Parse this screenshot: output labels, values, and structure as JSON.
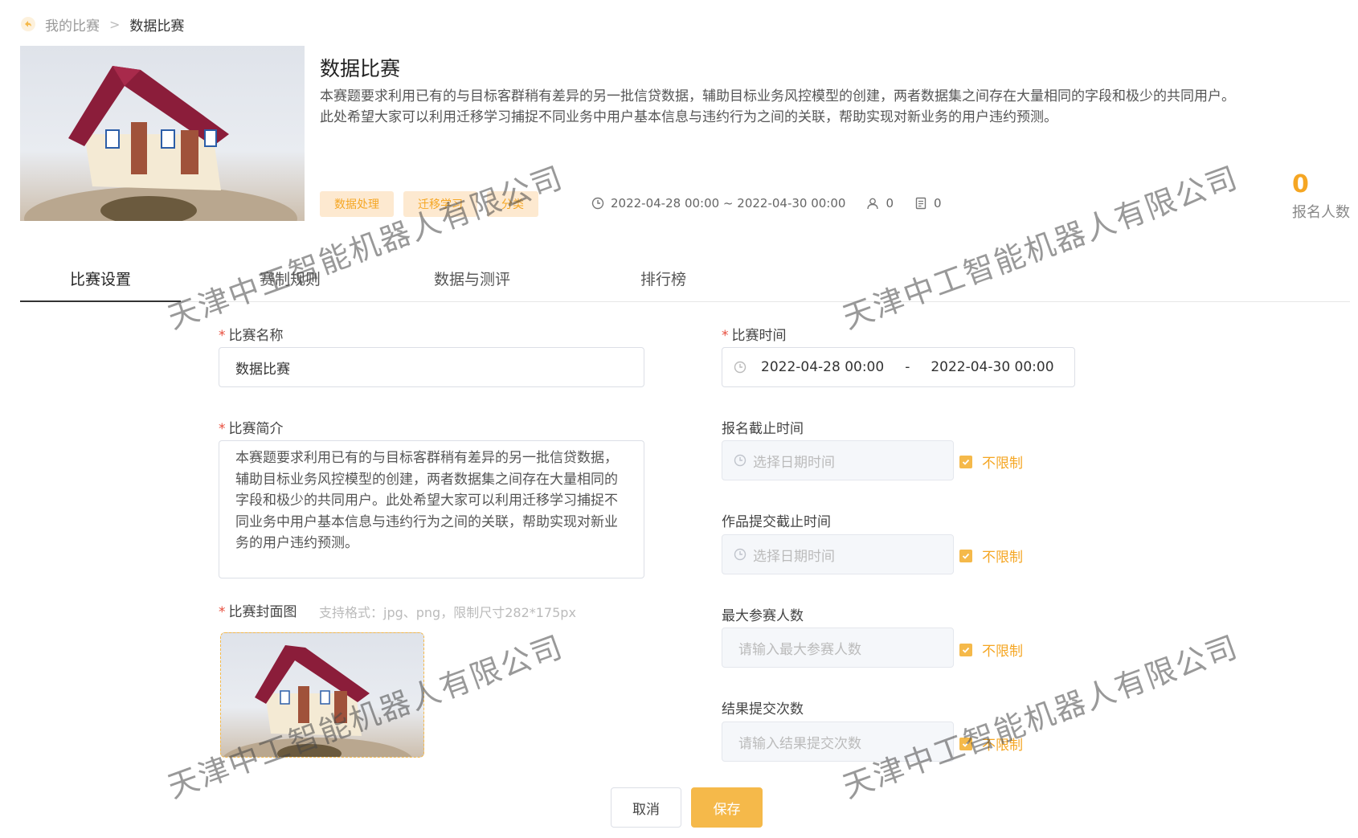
{
  "breadcrumb": {
    "parent": "我的比赛",
    "separator": ">",
    "current": "数据比赛"
  },
  "competition": {
    "title": "数据比赛",
    "description": "本赛题要求利用已有的与目标客群稍有差异的另一批信贷数据，辅助目标业务风控模型的创建，两者数据集之间存在大量相同的字段和极少的共同用户。此处希望大家可以利用迁移学习捕捉不同业务中用户基本信息与违约行为之间的关联，帮助实现对新业务的用户违约预测。",
    "tags": [
      "数据处理",
      "迁移学习",
      "分类"
    ],
    "time_range": "2022-04-28 00:00 ~ 2022-04-30 00:00",
    "participants": "0",
    "submissions": "0",
    "signup_count": "0",
    "signup_label": "报名人数"
  },
  "tabs": [
    "比赛设置",
    "赛制规则",
    "数据与测评",
    "排行榜"
  ],
  "form": {
    "name_label": "比赛名称",
    "name_value": "数据比赛",
    "intro_label": "比赛简介",
    "intro_value": "本赛题要求利用已有的与目标客群稍有差异的另一批信贷数据，辅助目标业务风控模型的创建，两者数据集之间存在大量相同的字段和极少的共同用户。此处希望大家可以利用迁移学习捕捉不同业务中用户基本信息与违约行为之间的关联，帮助实现对新业务的用户违约预测。",
    "cover_label": "比赛封面图",
    "cover_hint": "支持格式：jpg、png，限制尺寸282*175px",
    "time_label": "比赛时间",
    "time_start": "2022-04-28 00:00",
    "time_sep": "-",
    "time_end": "2022-04-30 00:00",
    "signup_deadline_label": "报名截止时间",
    "signup_deadline_placeholder": "选择日期时间",
    "submit_deadline_label": "作品提交截止时间",
    "submit_deadline_placeholder": "选择日期时间",
    "max_participants_label": "最大参赛人数",
    "max_participants_placeholder": "请输入最大参赛人数",
    "result_submits_label": "结果提交次数",
    "result_submits_placeholder": "请输入结果提交次数",
    "unlimited_label": "不限制"
  },
  "buttons": {
    "cancel": "取消",
    "save": "保存"
  },
  "watermark": "天津中工智能机器人有限公司",
  "colors": {
    "accent": "#f5b94a",
    "tag_bg": "#fde9d0",
    "required": "#e74c3c"
  }
}
